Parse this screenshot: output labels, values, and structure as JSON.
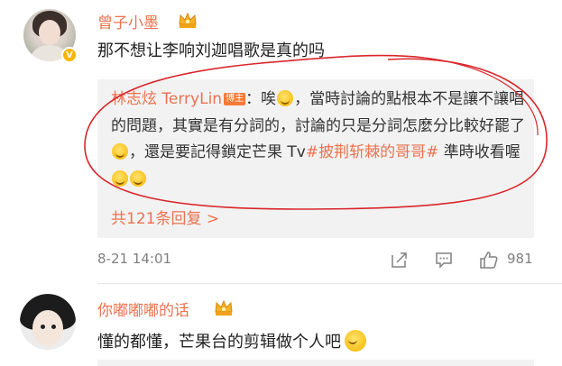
{
  "comments": [
    {
      "username": "曾子小墨",
      "text": "那不想让李响刘迦唱歌是真的吗",
      "verified_badge": "V",
      "reply": {
        "username": "林志炫 TerryLin",
        "tag": "博主",
        "text_1": "：唉",
        "text_2": "，當時討論的點根本不是讓不讓唱的問題，其實是有分詞的，討論的只是分詞怎麼分比較好罷了",
        "text_3": "，還是要記得鎖定芒果 Tv",
        "topic": "#披荆斩棘的哥哥#",
        "text_4": " 準時收看喔",
        "emojis": [
          "sweat-smile-icon",
          "smile-icon",
          "smile-icon",
          "kiss-icon"
        ]
      },
      "more_replies": "共121条回复 >",
      "time": "8-21 14:01",
      "like_count": "981",
      "icons": [
        "share-icon",
        "comment-icon",
        "like-icon"
      ]
    },
    {
      "username": "你嘟嘟嘟的话",
      "text": "懂的都懂，芒果台的剪辑做个人吧",
      "emoji": "grin-sweat-icon"
    }
  ],
  "colors": {
    "username": "#eb7350",
    "annotation": "#d9262b",
    "reply_bg": "#f2f2f2"
  }
}
